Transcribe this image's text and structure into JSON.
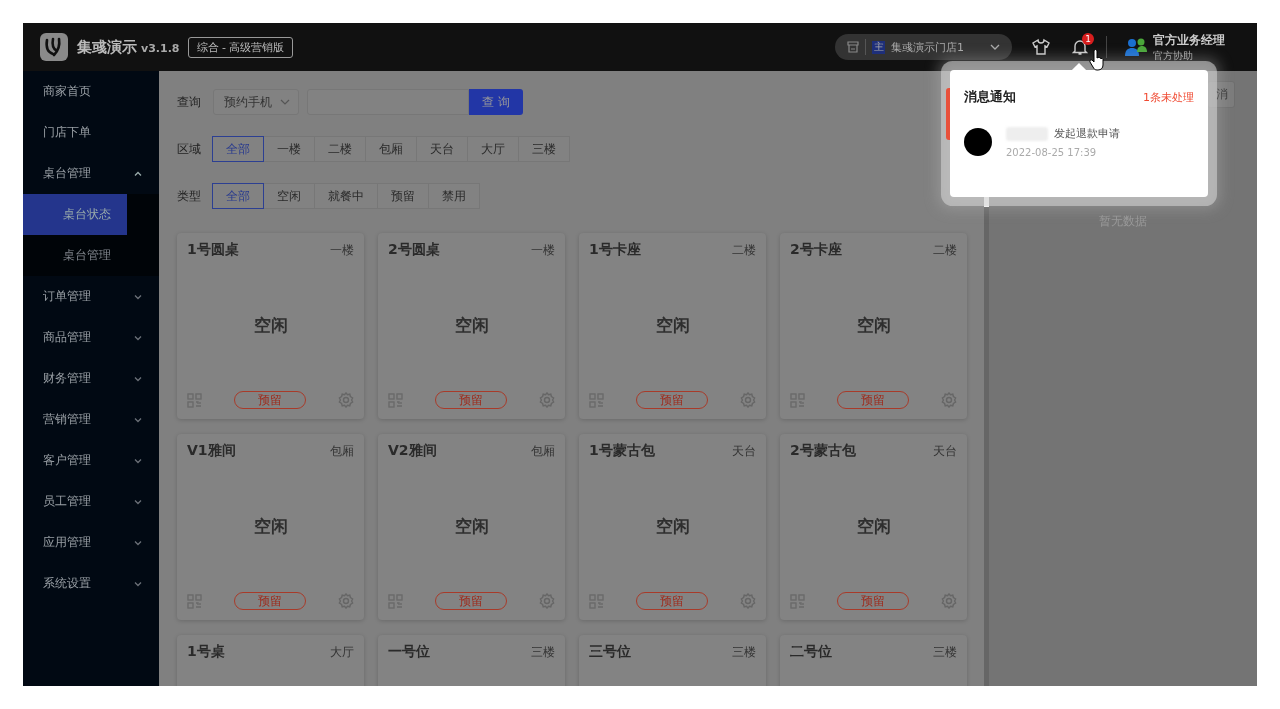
{
  "app": {
    "name": "集彧演示",
    "version": "v3.1.8",
    "edition": "综合 - 高级营销版"
  },
  "store": {
    "badge": "主",
    "name": "集彧演示门店1"
  },
  "notifications": {
    "count": "1"
  },
  "user": {
    "name": "官方业务经理",
    "role": "官方协助"
  },
  "sidebar": {
    "items": [
      {
        "label": "商家首页",
        "kind": "link",
        "selected": false
      },
      {
        "label": "门店下单",
        "kind": "link",
        "selected": false
      },
      {
        "label": "桌台管理",
        "kind": "group",
        "selected": false,
        "expanded": true,
        "children": [
          {
            "label": "桌台状态",
            "selected": true
          },
          {
            "label": "桌台管理",
            "selected": false
          }
        ]
      },
      {
        "label": "订单管理",
        "kind": "group",
        "selected": false,
        "expanded": false
      },
      {
        "label": "商品管理",
        "kind": "group",
        "selected": false,
        "expanded": false
      },
      {
        "label": "财务管理",
        "kind": "group",
        "selected": false,
        "expanded": false
      },
      {
        "label": "营销管理",
        "kind": "group",
        "selected": false,
        "expanded": false
      },
      {
        "label": "客户管理",
        "kind": "group",
        "selected": false,
        "expanded": false
      },
      {
        "label": "员工管理",
        "kind": "group",
        "selected": false,
        "expanded": false
      },
      {
        "label": "应用管理",
        "kind": "group",
        "selected": false,
        "expanded": false
      },
      {
        "label": "系统设置",
        "kind": "group",
        "selected": false,
        "expanded": false
      }
    ]
  },
  "filters": {
    "query": {
      "label": "查询",
      "field": "预约手机",
      "button": "查 询"
    },
    "region": {
      "label": "区域",
      "options": [
        {
          "label": "全部",
          "selected": true
        },
        {
          "label": "一楼",
          "selected": false
        },
        {
          "label": "二楼",
          "selected": false
        },
        {
          "label": "包厢",
          "selected": false
        },
        {
          "label": "天台",
          "selected": false
        },
        {
          "label": "大厅",
          "selected": false
        },
        {
          "label": "三楼",
          "selected": false
        }
      ]
    },
    "type": {
      "label": "类型",
      "options": [
        {
          "label": "全部",
          "selected": true
        },
        {
          "label": "空闲",
          "selected": false
        },
        {
          "label": "就餐中",
          "selected": false
        },
        {
          "label": "预留",
          "selected": false
        },
        {
          "label": "禁用",
          "selected": false
        }
      ]
    }
  },
  "tables": [
    {
      "name": "1号圆桌",
      "area": "一楼",
      "status": "空闲",
      "action": "预留"
    },
    {
      "name": "2号圆桌",
      "area": "一楼",
      "status": "空闲",
      "action": "预留"
    },
    {
      "name": "1号卡座",
      "area": "二楼",
      "status": "空闲",
      "action": "预留"
    },
    {
      "name": "2号卡座",
      "area": "二楼",
      "status": "空闲",
      "action": "预留"
    },
    {
      "name": "V1雅间",
      "area": "包厢",
      "status": "空闲",
      "action": "预留"
    },
    {
      "name": "V2雅间",
      "area": "包厢",
      "status": "空闲",
      "action": "预留"
    },
    {
      "name": "1号蒙古包",
      "area": "天台",
      "status": "空闲",
      "action": "预留"
    },
    {
      "name": "2号蒙古包",
      "area": "天台",
      "status": "空闲",
      "action": "预留"
    },
    {
      "name": "1号桌",
      "area": "大厅"
    },
    {
      "name": "一号位",
      "area": "三楼"
    },
    {
      "name": "三号位",
      "area": "三楼"
    },
    {
      "name": "二号位",
      "area": "三楼"
    }
  ],
  "right_panel": {
    "button": "消",
    "empty_text": "暂无数据"
  },
  "popup": {
    "title": "消息通知",
    "unread": "1条未处理",
    "items": [
      {
        "text": "发起退款申请",
        "time": "2022-08-25 17:39"
      }
    ]
  }
}
